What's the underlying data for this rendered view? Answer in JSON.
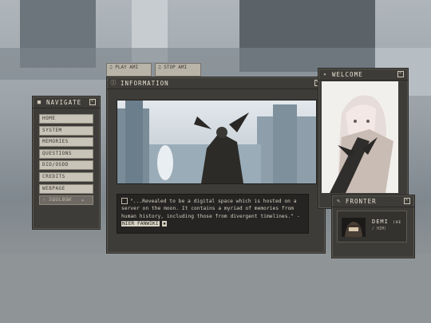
{
  "top_buttons": [
    {
      "icon": "♫",
      "label": "PLAY AMI"
    },
    {
      "icon": "♫",
      "label": "STOP AMI"
    }
  ],
  "navigate": {
    "title": "NAVIGATE",
    "items": [
      {
        "label": "HOME"
      },
      {
        "label": "SYSTEM"
      },
      {
        "label": "MEMORIES"
      },
      {
        "label": "QUESTIONS"
      },
      {
        "label": "DID/OSDD"
      },
      {
        "label": "CREDITS"
      },
      {
        "label": "WEBPAGE"
      },
      {
        "label": "✧ SOULBOX"
      }
    ],
    "pager": "◂ • ▸"
  },
  "information": {
    "title": "INFORMATION",
    "quote": "\"...Revealed to be a digital space which is hosted on a server on the moon. It contains a myriad of memories from human history, including those from divergent timelines.\" - ",
    "source": "NIER FANWIKI",
    "tail": "▪"
  },
  "welcome": {
    "title": "WELCOME"
  },
  "fronter": {
    "title": "FRONTER",
    "name": "DEMI",
    "pronoun": "(HE",
    "sub": "/ HIM)"
  },
  "colors": {
    "panel": "#3e3c38",
    "button": "#c9c4b8",
    "accent_text": "#dcd6c8"
  }
}
